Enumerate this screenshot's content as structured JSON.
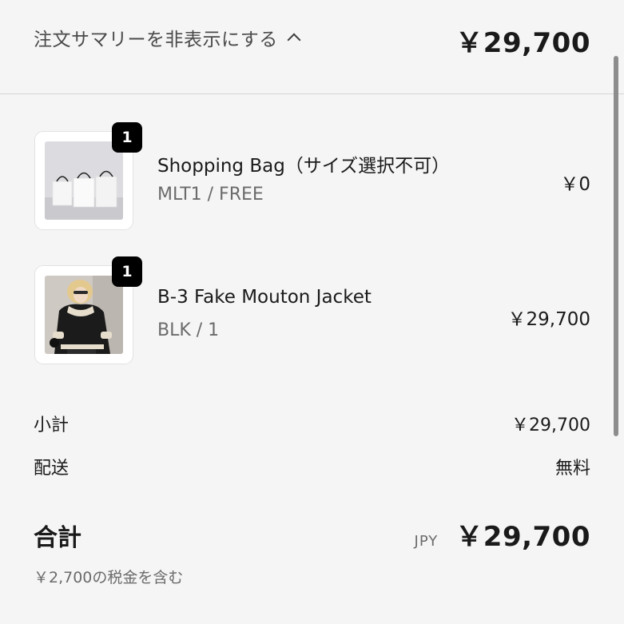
{
  "header": {
    "toggle_label": "注文サマリーを非表示にする",
    "total": "￥29,700"
  },
  "items": [
    {
      "name": "Shopping Bag（サイズ選択不可）",
      "variant": "MLT1 / FREE",
      "price": "￥0",
      "quantity": "1",
      "image": "shopping-bags-photo"
    },
    {
      "name": "B-3 Fake Mouton Jacket",
      "variant": "BLK / 1",
      "price": "￥29,700",
      "quantity": "1",
      "image": "jacket-model-photo"
    }
  ],
  "subtotal": {
    "label": "小計",
    "value": "￥29,700"
  },
  "shipping": {
    "label": "配送",
    "value": "無料"
  },
  "total": {
    "label": "合計",
    "currency": "JPY",
    "value": "￥29,700"
  },
  "tax_note": "￥2,700の税金を含む",
  "colors": {
    "background": "#f5f5f5",
    "text": "#1a1a1a",
    "muted": "#6b6b6b",
    "badge": "#000000",
    "divider": "#d6d6d6"
  }
}
